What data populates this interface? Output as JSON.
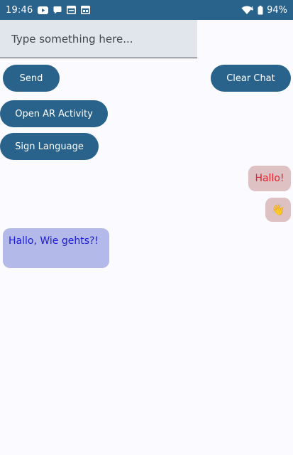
{
  "status_bar": {
    "time": "19:46",
    "battery_percent": "94%",
    "icons": [
      "youtube-icon",
      "chat-bubble-icon",
      "browser-icon",
      "window-icon",
      "wifi-icon",
      "battery-icon"
    ]
  },
  "input": {
    "placeholder": "Type something here...",
    "value": ""
  },
  "buttons": {
    "send": "Send",
    "clear_chat": "Clear Chat",
    "open_ar": "Open AR Activity",
    "sign_language": "Sign Language"
  },
  "messages": [
    {
      "side": "sent",
      "text": "Hallo!"
    },
    {
      "side": "sent",
      "text": "👋"
    },
    {
      "side": "received",
      "text": "Hallo, Wie gehts?!"
    }
  ],
  "colors": {
    "status_bar": "#29628a",
    "primary_button": "#29628a",
    "input_bg": "#e1e5ec",
    "sent_bubble": "#dec1c3",
    "sent_text": "#e0212d",
    "received_bubble": "#b3baea",
    "received_text": "#1d1ad9",
    "background": "#fbfbff"
  }
}
